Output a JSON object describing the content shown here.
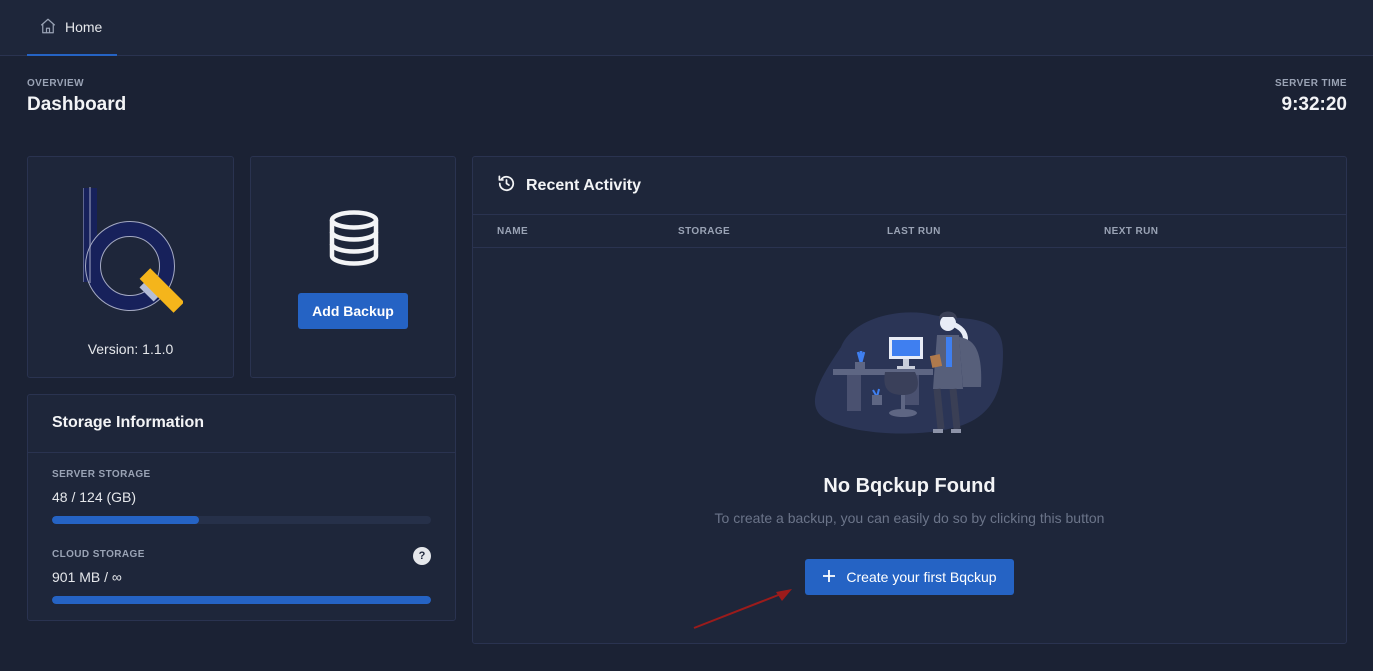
{
  "nav": {
    "home_label": "Home"
  },
  "header": {
    "overline": "OVERVIEW",
    "title": "Dashboard",
    "server_time_label": "SERVER TIME",
    "server_time": "9:32:20"
  },
  "logo_card": {
    "version": "Version: 1.1.0"
  },
  "backup_card": {
    "add_label": "Add Backup"
  },
  "storage": {
    "title": "Storage Information",
    "server": {
      "label": "SERVER STORAGE",
      "amount": "48 / 124 (GB)",
      "used_fraction": 0.387
    },
    "cloud": {
      "label": "CLOUD STORAGE",
      "amount": "901 MB / ∞",
      "used_fraction": 1.0,
      "help": "?"
    }
  },
  "activity": {
    "title": "Recent Activity",
    "columns": [
      "NAME",
      "STORAGE",
      "LAST RUN",
      "NEXT RUN"
    ],
    "empty_title": "No Bqckup Found",
    "empty_desc": "To create a backup, you can easily do so by clicking this button",
    "create_label": "Create your first Bqckup"
  },
  "colors": {
    "accent": "#2563c4",
    "logo_navy": "#17215b",
    "logo_yellow": "#f5b51b",
    "background": "#1b2234"
  },
  "icons": {
    "home": "home-icon",
    "database": "database-icon",
    "history": "history-icon",
    "plus": "plus-icon",
    "help": "help-icon"
  }
}
